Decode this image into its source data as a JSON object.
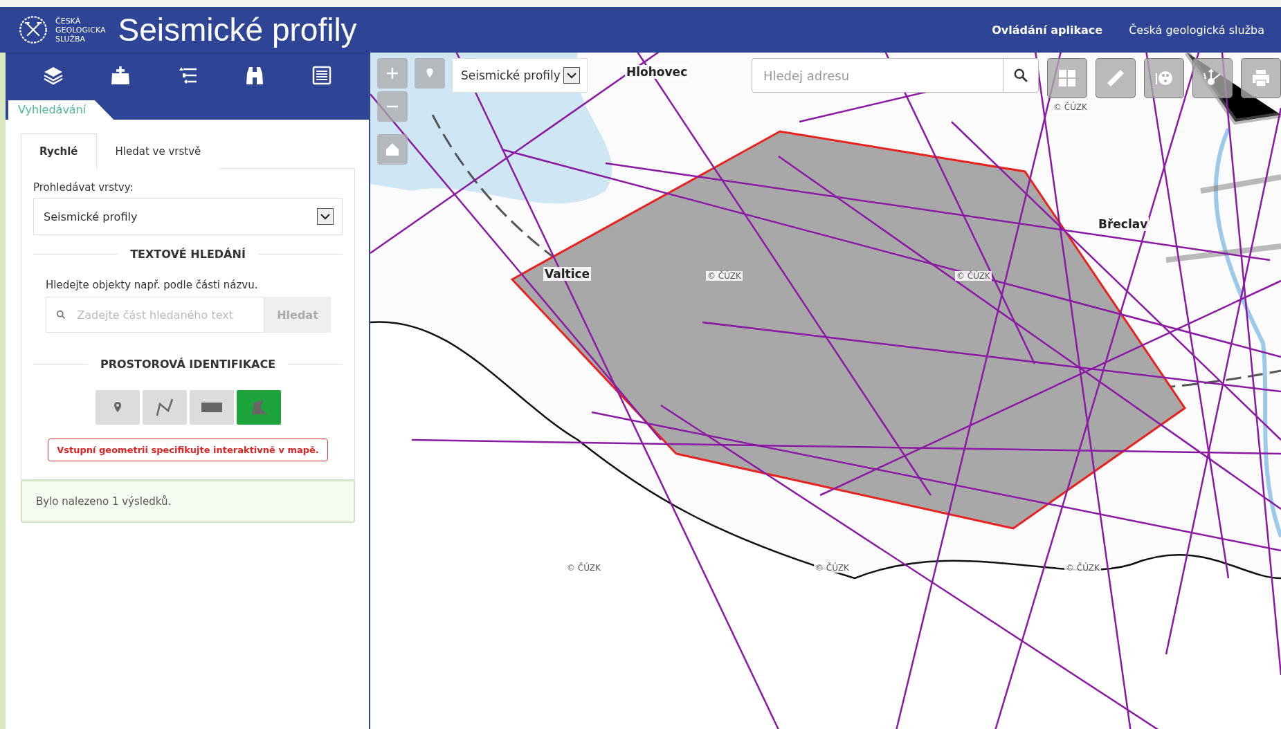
{
  "header": {
    "logo_lines": [
      "ČESKÁ",
      "GEOLOGICKA",
      "SLUŽBA"
    ],
    "title": "Seismické profily",
    "links": [
      {
        "label": "Ovládání aplikace",
        "bold": true
      },
      {
        "label": "Česká geologická služba",
        "bold": false
      }
    ]
  },
  "toolbar": [
    {
      "kind": "layers"
    },
    {
      "kind": "add-data"
    },
    {
      "kind": "legend"
    },
    {
      "kind": "binoculars"
    },
    {
      "kind": "table"
    }
  ],
  "panel_tab": "Vyhledávání",
  "subtabs": [
    {
      "label": "Rychlé",
      "selected": true
    },
    {
      "label": "Hledat ve vrstvě",
      "selected": false
    }
  ],
  "layer_select": {
    "label": "Prohledávat vrstvy:",
    "value": "Seismické profily"
  },
  "text_search": {
    "heading": "TEXTOVÉ HLEDÁNÍ",
    "hint": "Hledejte objekty např. podle části názvu.",
    "placeholder": "Zadejte část hledaného text",
    "button": "Hledat"
  },
  "spatial": {
    "heading": "PROSTOROVÁ IDENTIFIKACE",
    "tools": [
      {
        "kind": "point",
        "selected": false
      },
      {
        "kind": "line",
        "selected": false
      },
      {
        "kind": "rectangle",
        "selected": false
      },
      {
        "kind": "polygon",
        "selected": true
      }
    ],
    "message": "Vstupní geometrii specifikujte interaktivně v mapě."
  },
  "result": "Bylo nalezeno 1 výsledků.",
  "map": {
    "layer_select": "Seismické profily",
    "address_placeholder": "Hledej adresu",
    "tools": [
      {
        "kind": "basemap"
      },
      {
        "kind": "measure"
      },
      {
        "kind": "palette"
      },
      {
        "kind": "move"
      },
      {
        "kind": "print"
      }
    ],
    "labels": [
      {
        "text": "Hlohovec",
        "kind": "town"
      },
      {
        "text": "Valtice",
        "kind": "town"
      },
      {
        "text": "Břeclav",
        "kind": "town"
      },
      {
        "text": "© ČÚZK",
        "kind": "copyright"
      },
      {
        "text": "© ČÚZK",
        "kind": "copyright"
      },
      {
        "text": "© ČÚZK",
        "kind": "copyright"
      },
      {
        "text": "© ČÚZK",
        "kind": "copyright"
      },
      {
        "text": "© ČÚZK",
        "kind": "copyright"
      },
      {
        "text": "© ČÚZK",
        "kind": "copyright"
      }
    ]
  }
}
